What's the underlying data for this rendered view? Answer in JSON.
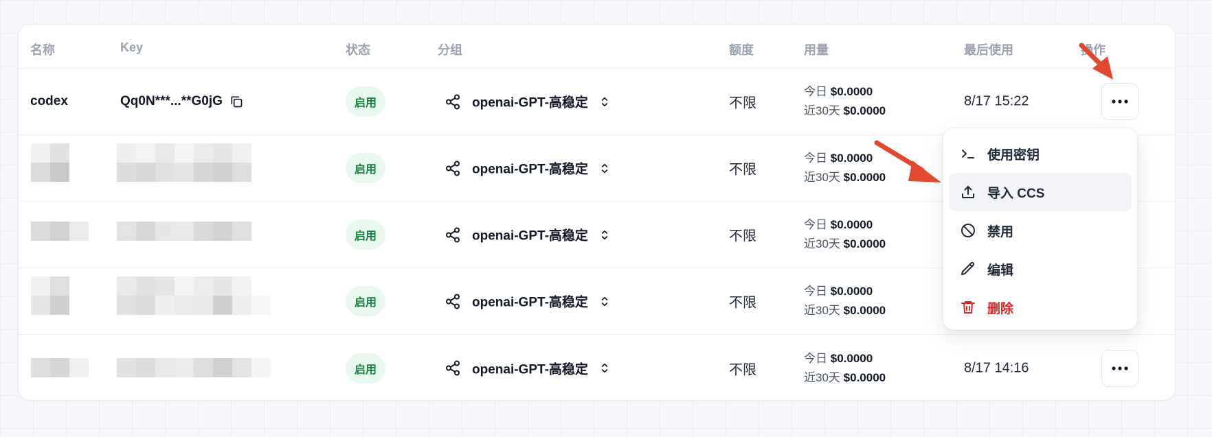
{
  "table": {
    "headers": {
      "name": "名称",
      "key": "Key",
      "status": "状态",
      "group": "分组",
      "quota": "额度",
      "usage": "用量",
      "last_used": "最后使用",
      "actions": "操作"
    },
    "rows": [
      {
        "name": "codex",
        "key": "Qq0N***...**G0jG",
        "status": "启用",
        "group": "openai-GPT-高稳定",
        "quota": "不限",
        "today_label": "今日",
        "today": "$0.0000",
        "month_label": "近30天",
        "month": "$0.0000",
        "last_used": "8/17 15:22"
      },
      {
        "name": "",
        "key": "",
        "status": "启用",
        "group": "openai-GPT-高稳定",
        "quota": "不限",
        "today_label": "今日",
        "today": "$0.0000",
        "month_label": "近30天",
        "month": "$0.0000",
        "last_used": ""
      },
      {
        "name": "",
        "key": "",
        "status": "启用",
        "group": "openai-GPT-高稳定",
        "quota": "不限",
        "today_label": "今日",
        "today": "$0.0000",
        "month_label": "近30天",
        "month": "$0.0000",
        "last_used": ""
      },
      {
        "name": "",
        "key": "",
        "status": "启用",
        "group": "openai-GPT-高稳定",
        "quota": "不限",
        "today_label": "今日",
        "today": "$0.0000",
        "month_label": "近30天",
        "month": "$0.0000",
        "last_used": ""
      },
      {
        "name": "",
        "key": "",
        "status": "启用",
        "group": "openai-GPT-高稳定",
        "quota": "不限",
        "today_label": "今日",
        "today": "$0.0000",
        "month_label": "近30天",
        "month": "$0.0000",
        "last_used": "8/17 14:16"
      }
    ]
  },
  "menu": {
    "items": [
      {
        "label": "使用密钥",
        "icon": "terminal-icon"
      },
      {
        "label": "导入 CCS",
        "icon": "upload-icon"
      },
      {
        "label": "禁用",
        "icon": "ban-icon"
      },
      {
        "label": "编辑",
        "icon": "pencil-icon"
      },
      {
        "label": "删除",
        "icon": "trash-icon"
      }
    ]
  },
  "colors": {
    "status_bg": "#e8f8ef",
    "status_text": "#15803d",
    "danger": "#dc2626",
    "annotation_arrow": "#e0492d"
  }
}
